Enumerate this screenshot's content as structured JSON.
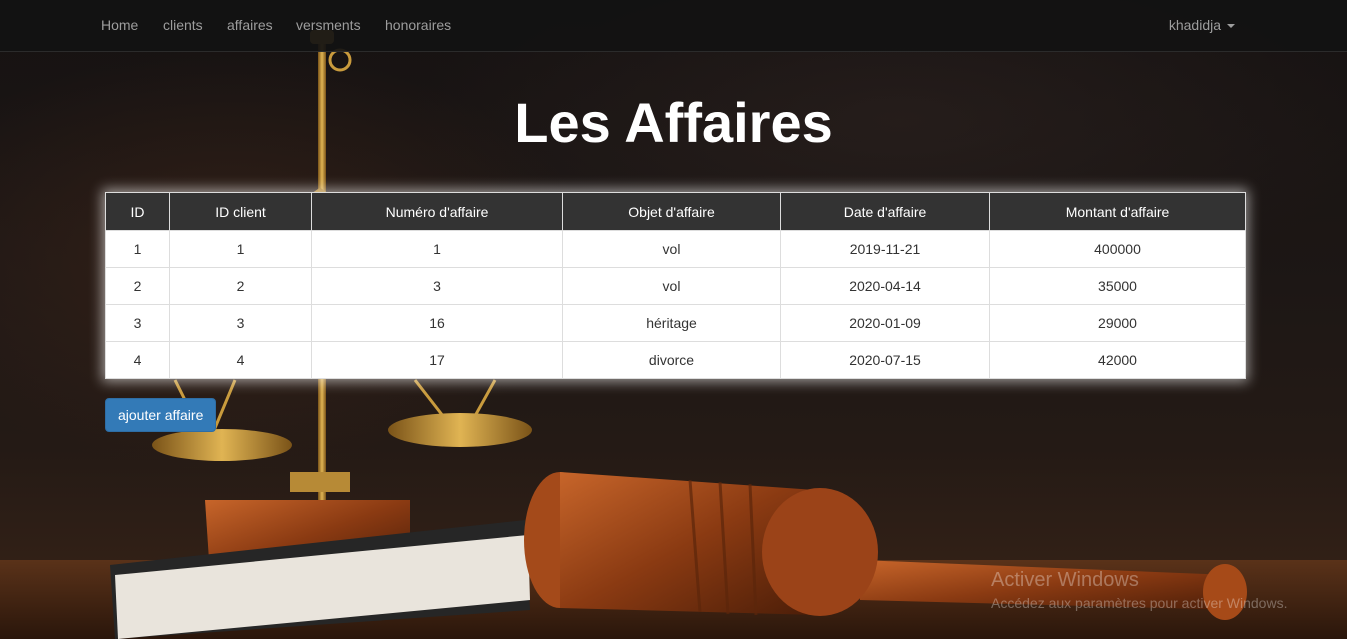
{
  "nav": {
    "links": [
      "Home",
      "clients",
      "affaires",
      "versments",
      "honoraires"
    ],
    "user": "khadidja"
  },
  "page": {
    "title": "Les Affaires"
  },
  "table": {
    "headers": [
      "ID",
      "ID client",
      "Numéro d'affaire",
      "Objet d'affaire",
      "Date d'affaire",
      "Montant d'affaire"
    ],
    "rows": [
      [
        "1",
        "1",
        "1",
        "vol",
        "2019-11-21",
        "400000"
      ],
      [
        "2",
        "2",
        "3",
        "vol",
        "2020-04-14",
        "35000"
      ],
      [
        "3",
        "3",
        "16",
        "héritage",
        "2020-01-09",
        "29000"
      ],
      [
        "4",
        "4",
        "17",
        "divorce",
        "2020-07-15",
        "42000"
      ]
    ]
  },
  "actions": {
    "add_label": "ajouter affaire"
  },
  "watermark": {
    "title": "Activer Windows",
    "subtitle": "Accédez aux paramètres pour activer Windows."
  },
  "colors": {
    "navbar": "#121212",
    "table_header": "#333333",
    "button": "#337ab7"
  }
}
